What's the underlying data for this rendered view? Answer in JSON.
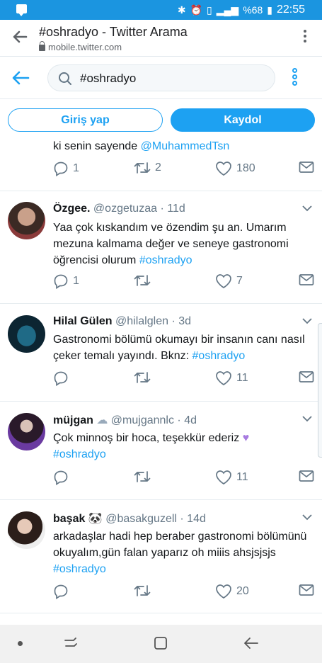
{
  "status_bar": {
    "battery": "%68",
    "time": "22:55"
  },
  "browser": {
    "title": "#oshradyo - Twitter Arama",
    "url": "mobile.twitter.com"
  },
  "search": {
    "query": "#oshradyo"
  },
  "auth": {
    "login_label": "Giriş yap",
    "signup_label": "Kaydol"
  },
  "tweets": [
    {
      "partial": true,
      "text_before": "ki senin sayende ",
      "mention": "@MuhammedTsn",
      "replies": "1",
      "retweets": "2",
      "likes": "180"
    },
    {
      "name": "Özgee.",
      "handle": "@ozgetuzaa",
      "time": "· 11d",
      "text": "Yaa çok kıskandım ve özendim şu an. Umarım mezuna kalmama değer ve seneye gastronomi öğrencisi olurum  ",
      "hashtag": "#oshradyo",
      "replies": "1",
      "retweets": "",
      "likes": "7"
    },
    {
      "name": "Hilal Gülen",
      "handle": "@hilalglen",
      "time": "· 3d",
      "text": "Gastronomi bölümü okumayı bir insanın canı nasıl çeker temalı yayındı. Bknz: ",
      "hashtag": "#oshradyo",
      "replies": "",
      "retweets": "",
      "likes": "11"
    },
    {
      "name": "müjgan",
      "handle": "@mujgannlc",
      "time": "· 4d",
      "text": "Çok minnoş bir hoca, teşekkür ederiz ",
      "hashtag": "#oshradyo",
      "replies": "",
      "retweets": "",
      "likes": "11"
    },
    {
      "name": "başak",
      "handle": "@basakguzell",
      "time": "· 14d",
      "text": "arkadaşlar hadi hep beraber gastronomi bölümünü okuyalım,gün falan yaparız oh miiis ahsjsjsjs ",
      "hashtag": "#oshradyo",
      "replies": "",
      "retweets": "",
      "likes": "20"
    }
  ],
  "colors": {
    "accent": "#1da1f2",
    "statusbar": "#1b95e0",
    "muted": "#657786"
  }
}
